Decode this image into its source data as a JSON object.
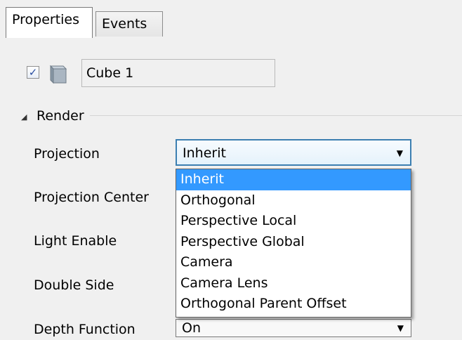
{
  "tabs": [
    "Properties",
    "Events"
  ],
  "object": {
    "enabled": true,
    "name": "Cube 1"
  },
  "section": {
    "title": "Render"
  },
  "properties": [
    {
      "label": "Projection"
    },
    {
      "label": "Projection Center"
    },
    {
      "label": "Light Enable"
    },
    {
      "label": "Double Side"
    },
    {
      "label": "Depth Function"
    }
  ],
  "projection_select": {
    "value": "Inherit",
    "options": [
      "Inherit",
      "Orthogonal",
      "Perspective Local",
      "Perspective Global",
      "Camera",
      "Camera Lens",
      "Orthogonal Parent Offset"
    ],
    "selected_index": 0
  },
  "depth_select": {
    "value": "On"
  },
  "colors": {
    "highlight": "#3399ff",
    "checkmark": "#2a4ea0"
  }
}
